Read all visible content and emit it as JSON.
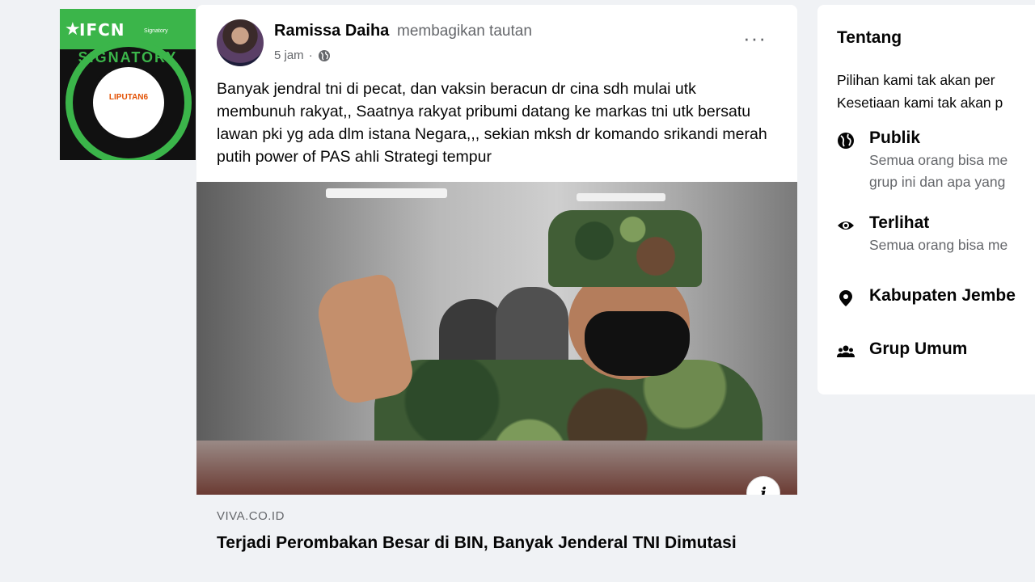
{
  "badge": {
    "brand": "IFCN",
    "sub": "Signatory",
    "ring_text": "SIGNATORY",
    "inner_text": "LIPUTAN6"
  },
  "post": {
    "author": "Ramissa Daiha",
    "action": "membagikan tautan",
    "time": "5 jam",
    "separator": "·",
    "more": "···",
    "text": "Banyak jendral tni di pecat, dan vaksin beracun dr cina sdh mulai utk membunuh rakyat,, Saatnya rakyat pribumi datang ke markas tni utk bersatu lawan pki yg ada dlm istana Negara,,, sekian mksh dr komando srikandi merah putih power of PAS ahli Strategi tempur",
    "info_button": "i",
    "link": {
      "domain": "VIVA.CO.ID",
      "title": "Terjadi Perombakan Besar di BIN, Banyak Jenderal TNI Dimutasi"
    }
  },
  "about": {
    "title": "Tentang",
    "desc_line1": "Pilihan kami tak akan per",
    "desc_line2": "Kesetiaan kami tak akan p",
    "items": [
      {
        "title": "Publik",
        "line1": "Semua orang bisa me",
        "line2": "grup ini dan apa yang",
        "icon": "globe-icon"
      },
      {
        "title": "Terlihat",
        "line1": "Semua orang bisa me",
        "icon": "eye-icon"
      },
      {
        "title": "Kabupaten Jembe",
        "icon": "location-pin-icon"
      },
      {
        "title": "Grup Umum",
        "icon": "group-icon"
      }
    ]
  }
}
